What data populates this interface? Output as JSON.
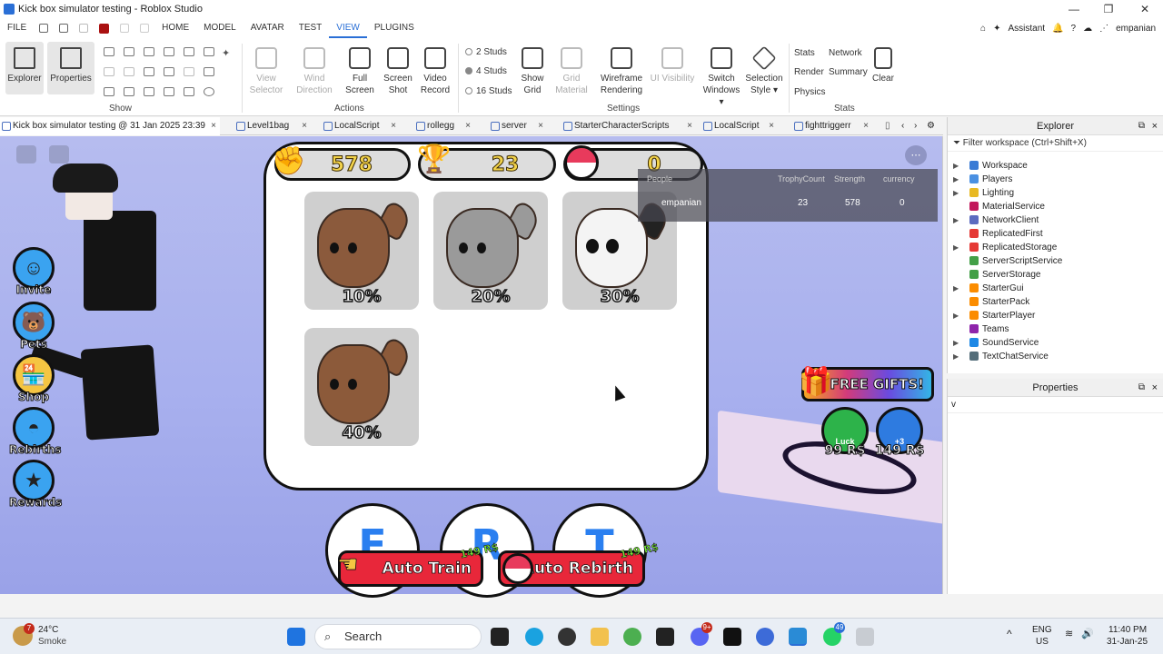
{
  "window": {
    "title": "Kick box simulator testing - Roblox Studio",
    "controls": [
      "—",
      "❐",
      "✕"
    ]
  },
  "menubar": {
    "items": [
      "FILE",
      "HOME",
      "MODEL",
      "AVATAR",
      "TEST",
      "VIEW",
      "PLUGINS"
    ],
    "active": "VIEW",
    "assistant": "Assistant",
    "user": "empanian"
  },
  "ribbon": {
    "show_group": {
      "label": "Show",
      "explorer": "Explorer",
      "properties": "Properties"
    },
    "actions_group": {
      "label": "Actions",
      "view_selector": [
        "View",
        "Selector"
      ],
      "wind_direction": [
        "Wind",
        "Direction"
      ],
      "full_screen": [
        "Full",
        "Screen"
      ],
      "screen_shot": [
        "Screen",
        "Shot"
      ],
      "video_record": [
        "Video",
        "Record"
      ]
    },
    "settings_group": {
      "label": "Settings",
      "studs": [
        "2 Studs",
        "4 Studs",
        "16 Studs"
      ],
      "selected_studs": "4 Studs",
      "show_grid": [
        "Show",
        "Grid"
      ],
      "grid_material": [
        "Grid",
        "Material"
      ],
      "wireframe": [
        "Wireframe",
        "Rendering"
      ],
      "ui_visibility": "UI Visibility",
      "switch_windows": [
        "Switch",
        "Windows ▾"
      ],
      "selection_style": [
        "Selection",
        "Style ▾"
      ]
    },
    "stats_group": {
      "label": "Stats",
      "stats": "Stats",
      "network": "Network",
      "render": "Render",
      "summary": "Summary",
      "physics": "Physics",
      "clear": "Clear"
    }
  },
  "tabs": [
    {
      "label": "Kick box simulator testing @ 31 Jan 2025 23:39",
      "active": true
    },
    {
      "label": "Level1bag"
    },
    {
      "label": "LocalScript"
    },
    {
      "label": "rollegg"
    },
    {
      "label": "server"
    },
    {
      "label": "StarterCharacterScripts"
    },
    {
      "label": "LocalScript"
    },
    {
      "label": "fighttriggerr"
    }
  ],
  "game": {
    "stats": {
      "strength": "578",
      "trophies": "23",
      "currency": "0"
    },
    "left_buttons": [
      "Invite",
      "Pets",
      "Shop",
      "Rebirths",
      "Rewards"
    ],
    "pets": [
      {
        "pct": "10%",
        "color": "#8b5a3c"
      },
      {
        "pct": "20%",
        "color": "#9a9a9a"
      },
      {
        "pct": "30%",
        "color": "#f4f4f4"
      },
      {
        "pct": "40%",
        "color": "#8c5a3a"
      }
    ],
    "leaderboard": {
      "headers": [
        "People",
        "TrophyCount",
        "Strength",
        "currency"
      ],
      "row": [
        "empanian",
        "23",
        "578",
        "0"
      ]
    },
    "free_gifts": "FREE GIFTS!",
    "shop_bubbles": [
      {
        "label": "Luck",
        "price": "99 R$",
        "color": "#2db34a"
      },
      {
        "label": "+3",
        "price": "149 R$",
        "color": "#2e7be0"
      }
    ],
    "letters": [
      "E",
      "R",
      "T"
    ],
    "auto_train": {
      "label": "Auto Train",
      "price": "149 R$"
    },
    "auto_rebirth": {
      "label": "Auto Rebirth",
      "price": "149 R$"
    }
  },
  "explorer": {
    "title": "Explorer",
    "filter_placeholder": "Filter workspace (Ctrl+Shift+X)",
    "items": [
      {
        "name": "Workspace",
        "expand": true,
        "color": "#3a7bd5"
      },
      {
        "name": "Players",
        "expand": true,
        "color": "#4a90e2"
      },
      {
        "name": "Lighting",
        "expand": true,
        "color": "#e8b923"
      },
      {
        "name": "MaterialService",
        "expand": false,
        "color": "#c2185b"
      },
      {
        "name": "NetworkClient",
        "expand": true,
        "color": "#5c6bc0"
      },
      {
        "name": "ReplicatedFirst",
        "expand": false,
        "color": "#e53935"
      },
      {
        "name": "ReplicatedStorage",
        "expand": true,
        "color": "#e53935"
      },
      {
        "name": "ServerScriptService",
        "expand": false,
        "color": "#43a047"
      },
      {
        "name": "ServerStorage",
        "expand": false,
        "color": "#43a047"
      },
      {
        "name": "StarterGui",
        "expand": true,
        "color": "#fb8c00"
      },
      {
        "name": "StarterPack",
        "expand": false,
        "color": "#fb8c00"
      },
      {
        "name": "StarterPlayer",
        "expand": true,
        "color": "#fb8c00"
      },
      {
        "name": "Teams",
        "expand": false,
        "color": "#8e24aa"
      },
      {
        "name": "SoundService",
        "expand": true,
        "color": "#1e88e5"
      },
      {
        "name": "TextChatService",
        "expand": true,
        "color": "#546e7a"
      }
    ]
  },
  "properties": {
    "title": "Properties",
    "filter_value": "v"
  },
  "taskbar": {
    "weather_temp": "24°C",
    "weather_desc": "Smoke",
    "weather_badge": "7",
    "search": "Search",
    "lang": "ENG",
    "region": "US",
    "time": "11:40 PM",
    "date": "31-Jan-25",
    "discord_badge": "9+",
    "whatsapp_badge": "49"
  }
}
